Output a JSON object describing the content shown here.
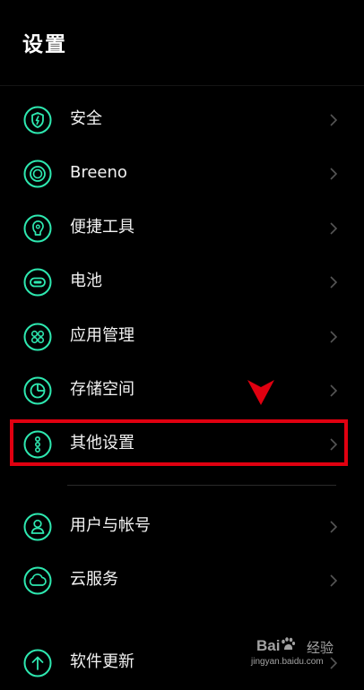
{
  "header": {
    "title": "设置"
  },
  "settings": {
    "items": [
      {
        "label": "安全",
        "icon": "shield-icon"
      },
      {
        "label": "Breeno",
        "icon": "breeno-icon"
      },
      {
        "label": "便捷工具",
        "icon": "convenience-tools-icon"
      },
      {
        "label": "电池",
        "icon": "battery-icon"
      },
      {
        "label": "应用管理",
        "icon": "app-management-icon"
      },
      {
        "label": "存储空间",
        "icon": "storage-icon"
      },
      {
        "label": "其他设置",
        "icon": "more-settings-icon"
      },
      {
        "label": "用户与帐号",
        "icon": "user-account-icon"
      },
      {
        "label": "云服务",
        "icon": "cloud-icon"
      },
      {
        "label": "软件更新",
        "icon": "update-icon"
      }
    ]
  },
  "colors": {
    "background": "#000000",
    "icon_accent": "#2ee8b0",
    "highlight": "#e00010",
    "text": "#f2f2f2"
  },
  "watermark": {
    "brand_left": "Bai",
    "brand_right": "经验",
    "url": "jingyan.baidu.com"
  }
}
